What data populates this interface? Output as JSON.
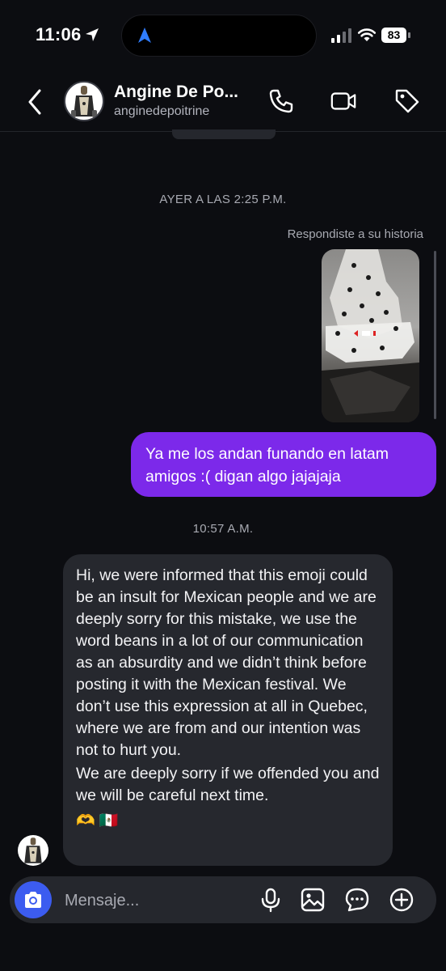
{
  "status_bar": {
    "time": "11:06",
    "battery": "83",
    "icons": [
      "location-arrow-icon",
      "navigation-icon",
      "cellular-signal-icon",
      "wifi-icon",
      "battery-icon"
    ]
  },
  "header": {
    "name": "Angine De Po...",
    "username": "anginedepoitrine",
    "icons": [
      "back-chevron-icon",
      "phone-icon",
      "video-camera-icon",
      "tag-icon"
    ]
  },
  "conversation": {
    "timestamp_1": "AYER A LAS 2:25 P.M.",
    "story_reply_label": "Respondiste a su historia",
    "my_message": "Ya me los andan funando en latam amigos :( digan algo jajajaja",
    "timestamp_2": "10:57 A.M.",
    "their_message": {
      "paragraph_1": "Hi, we were informed that this emoji could be an insult for Mexican people and we are deeply sorry for this mistake, we use the word beans in a lot of our communication as an absurdity and we didn’t think before posting it with the Mexican festival. We don’t use this expression at all in Quebec, where we are from and our intention was not to hurt you.",
      "paragraph_2": "We are deeply sorry if we offended you and we will be careful next time.",
      "emojis": "🫶 🇲🇽"
    }
  },
  "composer": {
    "placeholder": "Mensaje...",
    "icons": [
      "camera-icon",
      "microphone-icon",
      "image-icon",
      "sticker-chat-icon",
      "plus-circle-icon"
    ]
  },
  "colors": {
    "background": "#0c0d11",
    "my_bubble": "#7c29ea",
    "their_bubble": "#26282e",
    "camera_button": "#3c5cf0",
    "secondary_text": "#a8aab2"
  }
}
